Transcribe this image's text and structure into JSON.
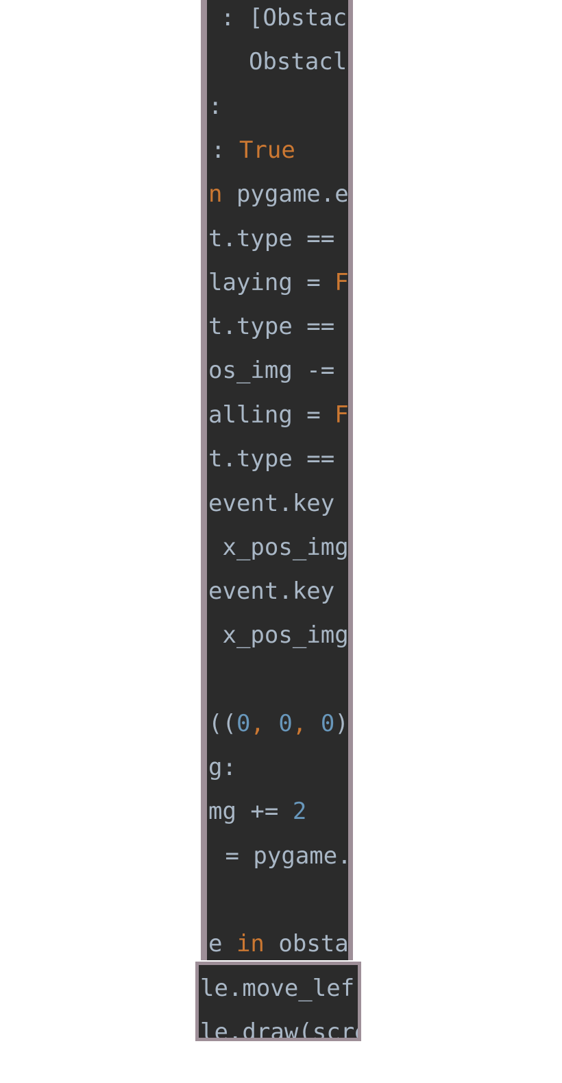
{
  "colors": {
    "background": "#2b2b2b",
    "frame": "#9e8f98",
    "text": "#a9b7c6",
    "keyword": "#cc7832",
    "number": "#6897bb"
  },
  "lines": [
    {
      "t1": ": [Obstacle",
      "t2": "",
      "t3": ""
    },
    {
      "t1": "  Obstacle",
      "t2": "",
      "t3": ""
    },
    {
      "t1": ":",
      "t2": "",
      "t3": ""
    },
    {
      "t1": ": ",
      "t2": "True",
      "t3": ""
    },
    {
      "t1": "",
      "t2": "n",
      "t3": " pygame.e"
    },
    {
      "t1": "t.type ==",
      "t2": "",
      "t3": ""
    },
    {
      "t1": "laying = ",
      "t2": "F",
      "t3": ""
    },
    {
      "t1": "t.type ==",
      "t2": "",
      "t3": ""
    },
    {
      "t1": "os_img -=",
      "t2": "",
      "t3": ""
    },
    {
      "t1": "alling = ",
      "t2": "F",
      "t3": ""
    },
    {
      "t1": "t.type ==",
      "t2": "",
      "t3": ""
    },
    {
      "t1": "event.key",
      "t2": "",
      "t3": ""
    },
    {
      "t1": " x_pos_img",
      "t2": "",
      "t3": ""
    },
    {
      "t1": "event.key",
      "t2": "",
      "t3": ""
    },
    {
      "t1": " x_pos_img",
      "t2": "",
      "t3": ""
    },
    {
      "t1": "",
      "t2": "",
      "t3": ""
    },
    {
      "t1": "((",
      "n1": "0",
      "s1": ", ",
      "n2": "0",
      "s2": ", ",
      "n3": "0",
      "s3": ")"
    },
    {
      "t1": "g:",
      "t2": "",
      "t3": ""
    },
    {
      "t1": "mg += ",
      "t2": "2",
      "t3": ""
    },
    {
      "t1": " = pygame.",
      "t2": "",
      "t3": ""
    },
    {
      "t1": "",
      "t2": "",
      "t3": ""
    },
    {
      "t1": "e ",
      "t2": "in",
      "t3": " obsta"
    }
  ],
  "lines2": [
    {
      "t1": "le.move_lef"
    },
    {
      "t1": "le.draw(scre"
    }
  ]
}
